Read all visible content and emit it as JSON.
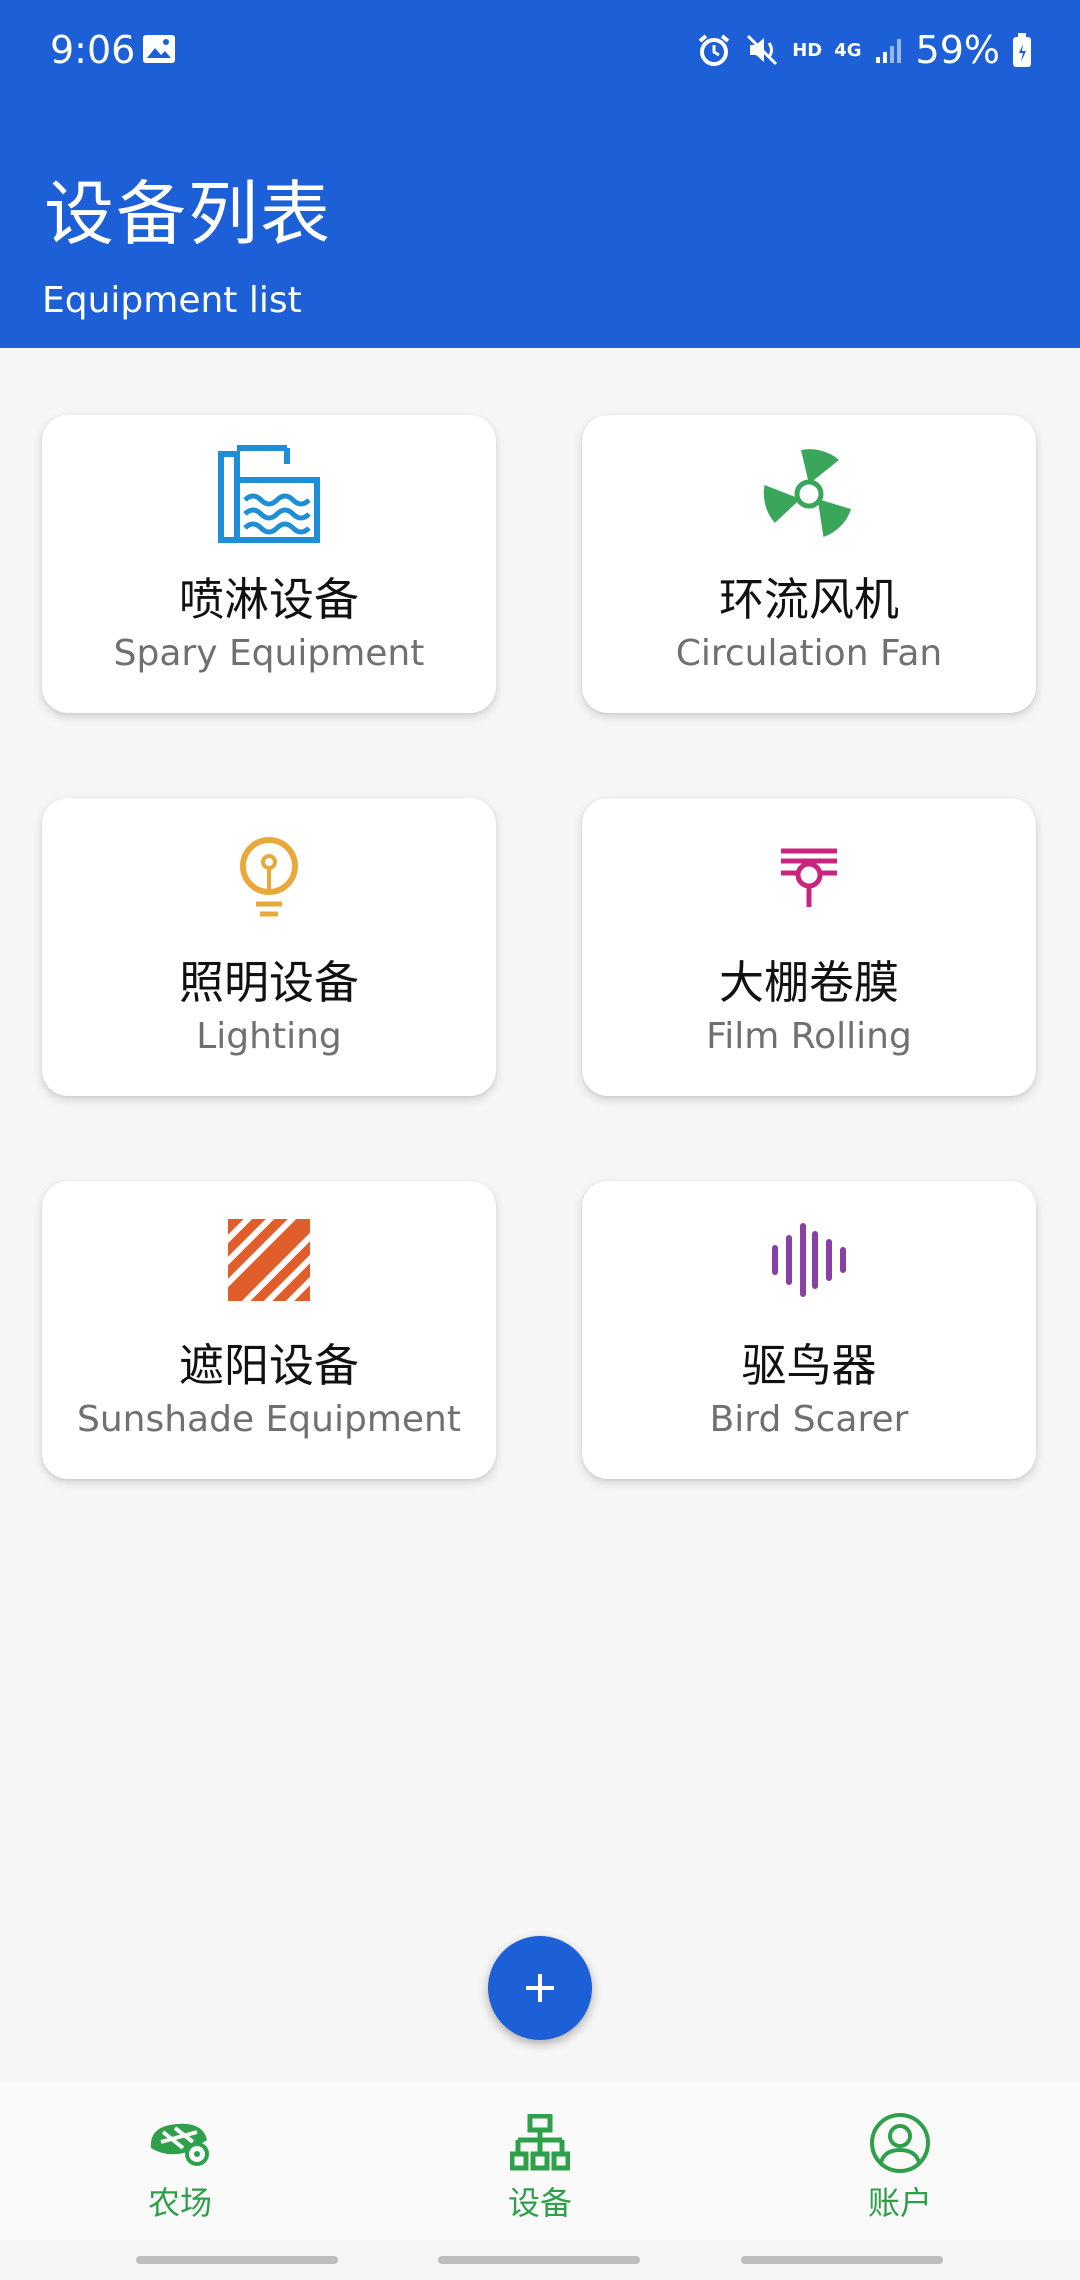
{
  "status_bar": {
    "time": "9:06",
    "network": "4G",
    "hd_label": "HD",
    "battery": "59%"
  },
  "header": {
    "title": "设备列表",
    "subtitle": "Equipment list"
  },
  "equipment": [
    {
      "cn": "喷淋设备",
      "en": "Spary Equipment",
      "icon": "spray-icon",
      "color": "#1e8fd6"
    },
    {
      "cn": "环流风机",
      "en": "Circulation Fan",
      "icon": "fan-icon",
      "color": "#3aa65a"
    },
    {
      "cn": "照明设备",
      "en": "Lighting",
      "icon": "lightbulb-icon",
      "color": "#e8a93a"
    },
    {
      "cn": "大棚卷膜",
      "en": "Film Rolling",
      "icon": "film-rolling-icon",
      "color": "#c9257f"
    },
    {
      "cn": "遮阳设备",
      "en": "Sunshade Equipment",
      "icon": "sunshade-icon",
      "color": "#e05e2b"
    },
    {
      "cn": "驱鸟器",
      "en": "Bird Scarer",
      "icon": "sound-wave-icon",
      "color": "#8a3fa5"
    }
  ],
  "fab": {
    "icon": "plus-icon"
  },
  "bottom_nav": [
    {
      "label": "农场",
      "icon": "farm-icon"
    },
    {
      "label": "设备",
      "icon": "device-icon"
    },
    {
      "label": "账户",
      "icon": "account-icon"
    }
  ],
  "colors": {
    "primary": "#1c5fd6",
    "nav_active": "#2ea04a",
    "background": "#f6f6f6"
  }
}
